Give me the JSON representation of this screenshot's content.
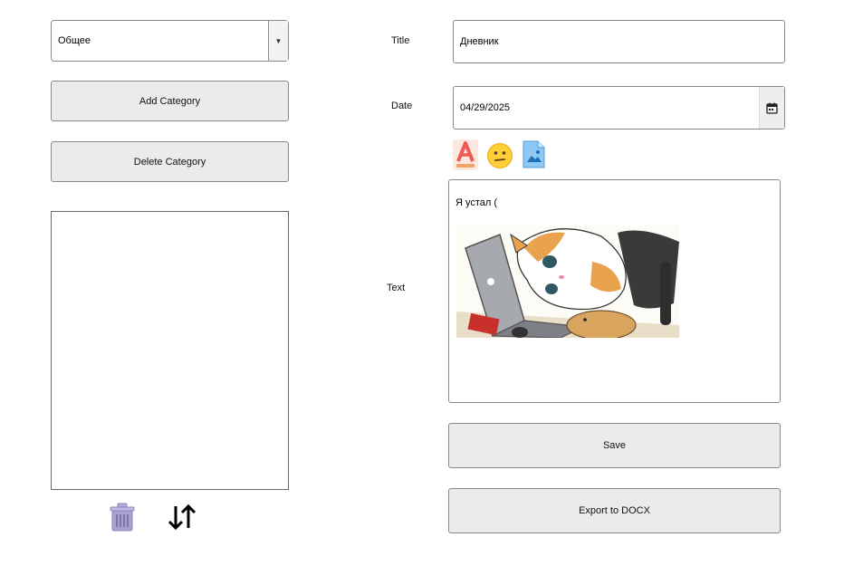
{
  "category": {
    "selected": "Общее"
  },
  "buttons": {
    "add_category": "Add Category",
    "delete_category": "Delete Category",
    "save": "Save",
    "export": "Export to DOCX"
  },
  "labels": {
    "title": "Title",
    "date": "Date",
    "text": "Text"
  },
  "entry": {
    "title": "Дневник",
    "date": "04/29/2025",
    "text": "Я устал (",
    "image": "cat-at-laptop-illustration"
  },
  "toolbar": {
    "icons": [
      "text-color-icon",
      "emoji-icon",
      "insert-image-icon"
    ]
  },
  "list_tools": {
    "icons": [
      "trash-icon",
      "sort-icon"
    ]
  },
  "colors": {
    "button_bg": "#ebebeb",
    "border": "#8a8a8a",
    "trash": "#a9a0cf",
    "font_icon": "#ef5a52"
  }
}
